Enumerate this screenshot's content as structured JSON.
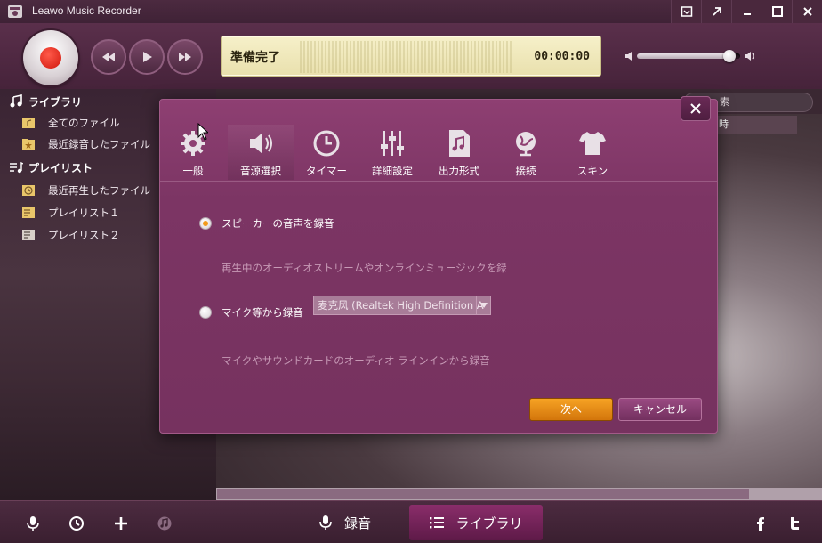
{
  "window": {
    "title": "Leawo Music Recorder"
  },
  "player": {
    "status": "準備完了",
    "time": "00:00:00",
    "volume": 0.9
  },
  "sidebar": {
    "library_header": "ライブラリ",
    "library_items": [
      "全てのファイル",
      "最近録音したファイル"
    ],
    "playlist_header": "プレイリスト",
    "playlist_items": [
      "最近再生したファイル",
      "プレイリスト１",
      "プレイリスト２"
    ]
  },
  "main": {
    "search_label": "索",
    "column_header": "時"
  },
  "dialog": {
    "tabs": [
      {
        "label": "一般",
        "icon": "gear-icon"
      },
      {
        "label": "音源選択",
        "icon": "speaker-icon"
      },
      {
        "label": "タイマー",
        "icon": "clock-icon"
      },
      {
        "label": "詳細設定",
        "icon": "sliders-icon"
      },
      {
        "label": "出力形式",
        "icon": "music-file-icon"
      },
      {
        "label": "接続",
        "icon": "globe-icon"
      },
      {
        "label": "スキン",
        "icon": "shirt-icon"
      }
    ],
    "active_tab": "音源選択",
    "option_speaker_label": "スピーカーの音声を録音",
    "option_speaker_desc": "再生中のオーディオストリームやオンラインミュージックを録",
    "option_mic_label": "マイク等から録音",
    "mic_device": "麦克风 (Realtek High Definition A",
    "option_mic_desc": "マイクやサウンドカードのオーディオ ラインインから録音",
    "selected_option": "speaker",
    "next_button": "次へ",
    "cancel_button": "キャンセル"
  },
  "bottombar": {
    "record_tab": "録音",
    "library_tab": "ライブラリ",
    "active_tab": "library"
  },
  "colors": {
    "accent_orange": "#f29a1a",
    "dialog_bg": "#7c3564",
    "record_red": "#d0160c"
  }
}
